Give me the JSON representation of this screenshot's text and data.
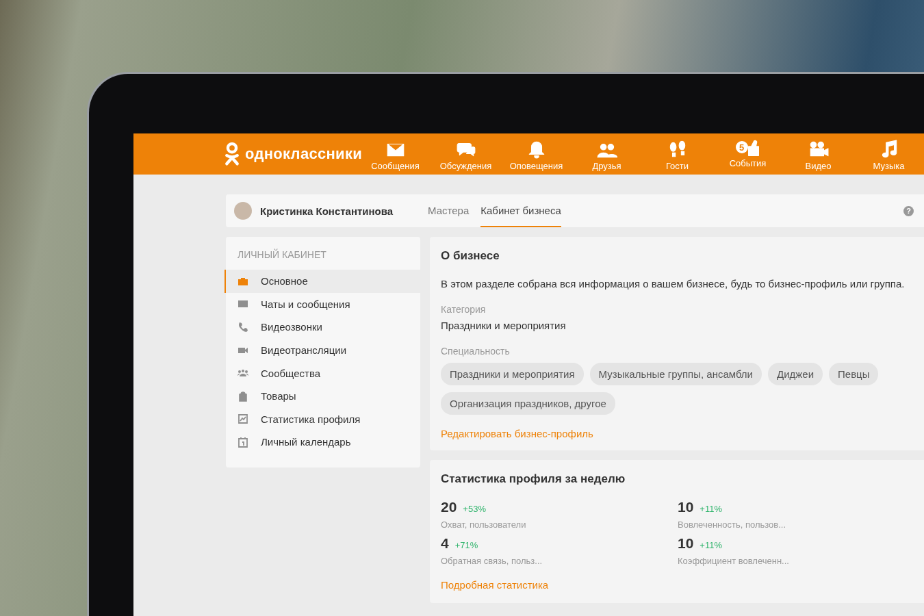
{
  "topbar": {
    "logo": "одноклассники",
    "nav": [
      {
        "label": "Сообщения"
      },
      {
        "label": "Обсуждения"
      },
      {
        "label": "Оповещения"
      },
      {
        "label": "Друзья"
      },
      {
        "label": "Гости"
      },
      {
        "label": "События",
        "badge": "5"
      },
      {
        "label": "Видео"
      },
      {
        "label": "Музыка"
      }
    ]
  },
  "header": {
    "user_name": "Кристинка Константинова",
    "tabs": [
      {
        "label": "Мастера",
        "selected": false
      },
      {
        "label": "Кабинет бизнеса",
        "selected": true
      }
    ],
    "help": "?"
  },
  "sidebar": {
    "title": "ЛИЧНЫЙ КАБИНЕТ",
    "items": [
      {
        "label": "Основное",
        "selected": true
      },
      {
        "label": "Чаты и сообщения",
        "selected": false
      },
      {
        "label": "Видеозвонки",
        "selected": false
      },
      {
        "label": "Видеотрансляции",
        "selected": false
      },
      {
        "label": "Сообщества",
        "selected": false
      },
      {
        "label": "Товары",
        "selected": false
      },
      {
        "label": "Статистика профиля",
        "selected": false
      },
      {
        "label": "Личный календарь",
        "selected": false
      }
    ]
  },
  "about": {
    "title": "О бизнесе",
    "description": "В этом разделе собрана вся информация о вашем бизнесе, будь то бизнес-профиль или группа.",
    "category_label": "Категория",
    "category": "Праздники и мероприятия",
    "specialty_label": "Специальность",
    "specialties": [
      "Праздники и мероприятия",
      "Музыкальные группы, ансамбли",
      "Диджеи",
      "Певцы",
      "Организация праздников, другое"
    ],
    "edit_link": "Редактировать бизнес-профиль"
  },
  "stats": {
    "title": "Статистика профиля за неделю",
    "items": [
      {
        "value": "20",
        "change": "+53%",
        "label": "Охват, пользователи"
      },
      {
        "value": "10",
        "change": "+11%",
        "label": "Вовлеченность, пользов..."
      },
      {
        "value": "4",
        "change": "+71%",
        "label": "Обратная связь, польз..."
      },
      {
        "value": "10",
        "change": "+11%",
        "label": "Коэффициент вовлеченн..."
      }
    ],
    "link": "Подробная статистика"
  }
}
